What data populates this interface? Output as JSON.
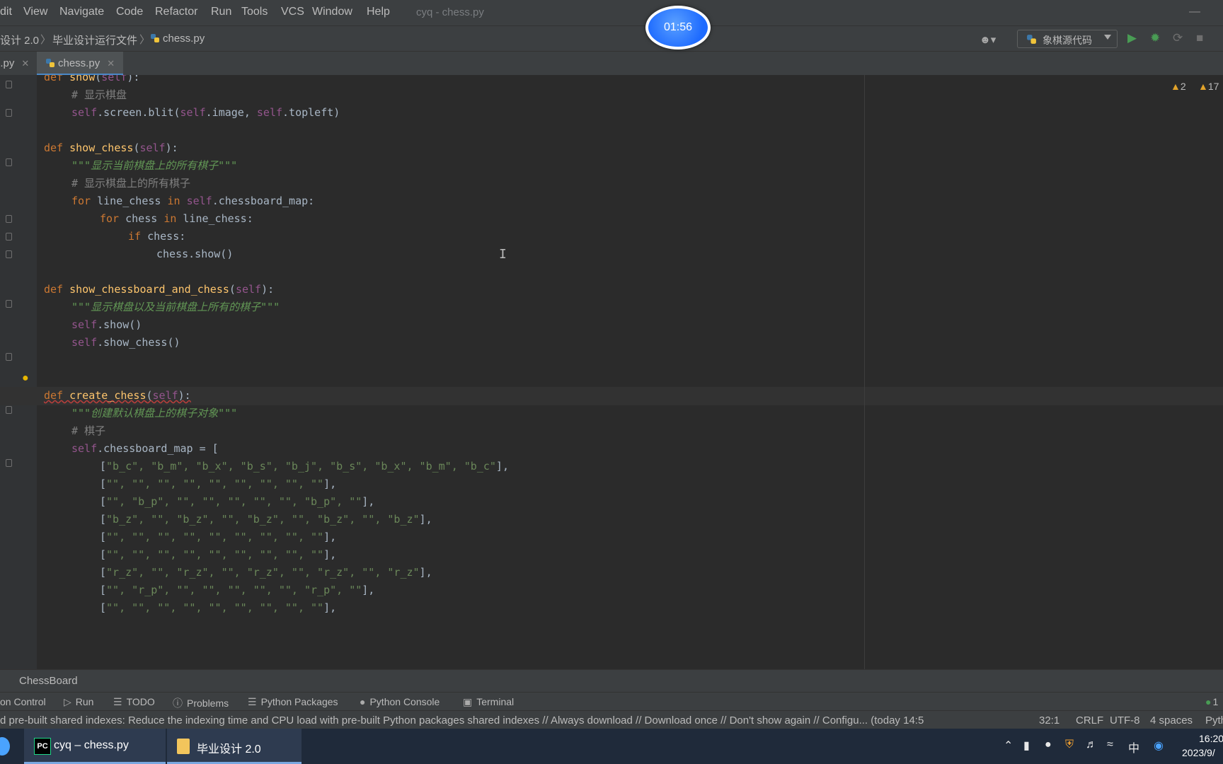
{
  "window": {
    "title": "cyq - chess.py",
    "timer": "01:56"
  },
  "menu": [
    "dit",
    "View",
    "Navigate",
    "Code",
    "Refactor",
    "Run",
    "Tools",
    "VCS",
    "Window",
    "Help"
  ],
  "breadcrumb": {
    "project": "设计 2.0",
    "folder": "毕业设计运行文件",
    "file": "chess.py"
  },
  "toolbar": {
    "run_config": "象棋源代码"
  },
  "tabs": [
    {
      "label": "n.py"
    },
    {
      "label": "chess.py",
      "active": true
    }
  ],
  "inspections": {
    "warnings": "2",
    "weak_warnings": "17"
  },
  "code": {
    "l1_kw": "def ",
    "l1_fn": "show",
    "l1_a": "(",
    "l1_self": "self",
    "l1_b": "):",
    "l2_cm": "# 显示棋盘",
    "l3_self1": "self",
    "l3_a": ".screen.blit(",
    "l3_self2": "self",
    "l3_b": ".image, ",
    "l3_self3": "self",
    "l3_c": ".topleft)",
    "l5_kw": "def ",
    "l5_fn": "show_chess",
    "l5_a": "(",
    "l5_self": "self",
    "l5_b": "):",
    "l6_doc": "\"\"\"显示当前棋盘上的所有棋子\"\"\"",
    "l7_cm": "# 显示棋盘上的所有棋子",
    "l8_kw1": "for ",
    "l8_a": "line_chess ",
    "l8_kw2": "in ",
    "l8_self": "self",
    "l8_b": ".chessboard_map:",
    "l9_kw1": "for ",
    "l9_a": "chess ",
    "l9_kw2": "in ",
    "l9_b": "line_chess:",
    "l10_kw": "if ",
    "l10_a": "chess:",
    "l11_a": "chess.show()",
    "l13_kw": "def ",
    "l13_fn": "show_chessboard_and_chess",
    "l13_a": "(",
    "l13_self": "self",
    "l13_b": "):",
    "l14_doc": "\"\"\"显示棋盘以及当前棋盘上所有的棋子\"\"\"",
    "l15_self": "self",
    "l15_a": ".show()",
    "l16_self": "self",
    "l16_a": ".show_chess()",
    "l19_kw": "def ",
    "l19_fn": "create_chess",
    "l19_a": "(",
    "l19_self": "self",
    "l19_b": "):",
    "l20_doc": "\"\"\"创建默认棋盘上的棋子对象\"\"\"",
    "l21_cm": "# 棋子",
    "l22_self": "self",
    "l22_a": ".chessboard_map = [",
    "l23_a": "[",
    "l23_s": "\"b_c\", \"b_m\", \"b_x\", \"b_s\", \"b_j\", \"b_s\", \"b_x\", \"b_m\", \"b_c\"",
    "l23_b": "],",
    "l24_a": "[",
    "l24_s": "\"\", \"\", \"\", \"\", \"\", \"\", \"\", \"\", \"\"",
    "l24_b": "],",
    "l25_a": "[",
    "l25_s": "\"\", \"b_p\", \"\", \"\", \"\", \"\", \"\", \"b_p\", \"\"",
    "l25_b": "],",
    "l26_a": "[",
    "l26_s": "\"b_z\", \"\", \"b_z\", \"\", \"b_z\", \"\", \"b_z\", \"\", \"b_z\"",
    "l26_b": "],",
    "l27_a": "[",
    "l27_s": "\"\", \"\", \"\", \"\", \"\", \"\", \"\", \"\", \"\"",
    "l27_b": "],",
    "l28_a": "[",
    "l28_s": "\"\", \"\", \"\", \"\", \"\", \"\", \"\", \"\", \"\"",
    "l28_b": "],",
    "l29_a": "[",
    "l29_s": "\"r_z\", \"\", \"r_z\", \"\", \"r_z\", \"\", \"r_z\", \"\", \"r_z\"",
    "l29_b": "],",
    "l30_a": "[",
    "l30_s": "\"\", \"r_p\", \"\", \"\", \"\", \"\", \"\", \"r_p\", \"\"",
    "l30_b": "],",
    "l31_a": "[",
    "l31_s": "\"\", \"\", \"\", \"\", \"\", \"\", \"\", \"\", \"\"",
    "l31_b": "],"
  },
  "structure": {
    "label": "ChessBoard"
  },
  "tool_windows": [
    "on Control",
    "Run",
    "TODO",
    "Problems",
    "Python Packages",
    "Python Console",
    "Terminal"
  ],
  "status": {
    "message": "d pre-built shared indexes: Reduce the indexing time and CPU load with pre-built Python packages shared indexes // Always download // Download once // Don't show again // Configu... (today 14:5",
    "position": "32:1",
    "line_sep": "CRLF",
    "encoding": "UTF-8",
    "indent": "4 spaces",
    "interpreter": "Pyth",
    "event_count": "1"
  },
  "taskbar": {
    "apps": [
      {
        "label": "cyq – chess.py"
      },
      {
        "label": "毕业设计 2.0"
      }
    ],
    "ime": "中",
    "time": "16:20",
    "date": "2023/9/"
  },
  "colors": {
    "editor_bg": "#2b2b2b",
    "keyword": "#cc7832",
    "function": "#ffc66d",
    "self": "#94558d",
    "string": "#6a8759",
    "docstring": "#629755",
    "comment": "#808080"
  }
}
